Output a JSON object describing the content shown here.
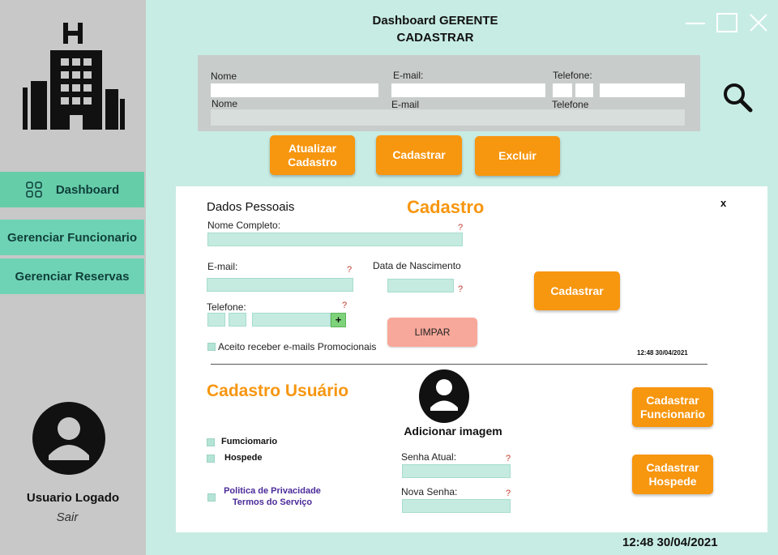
{
  "header": {
    "title_line1": "Dashboard GERENTE",
    "title_line2": "CADASTRAR"
  },
  "window_controls": [
    "minimize-icon",
    "maximize-icon",
    "close-icon"
  ],
  "sidebar": {
    "items": [
      {
        "label": "Dashboard",
        "icon": "dashboard-icon"
      },
      {
        "label": "Gerenciar Funcionario"
      },
      {
        "label": "Gerenciar Reservas"
      }
    ],
    "user_name": "Usuario Logado",
    "logout": "Sair"
  },
  "search": {
    "nome_label": "Nome",
    "email_label": "E-mail:",
    "telefone_label": "Telefone:",
    "col_nome": "Nome",
    "col_email": "E-mail",
    "col_telefone": "Telefone"
  },
  "actions": {
    "atualizar": "Atualizar Cadastro",
    "cadastrar": "Cadastrar",
    "excluir": "Excluir"
  },
  "cadastro": {
    "section_label": "Dados  Pessoais",
    "title": "Cadastro",
    "close": "x",
    "nome_completo_label": "Nome Completo:",
    "email_label": "E-mail:",
    "nascimento_label": "Data de Nascimento",
    "telefone_label": "Telefone:",
    "phone_add": "+",
    "limpar": "LIMPAR",
    "promo_label": "Aceito receber e-mails Promocionais",
    "cadastrar": "Cadastrar",
    "timestamp": "12:48  30/04/2021",
    "required_mark": "?"
  },
  "usuario": {
    "title": "Cadastro Usuário",
    "add_image": "Adicionar imagem",
    "funcionario_label": "Fumciomario",
    "hospede_label": "Hospede",
    "privacy_line1": "Politica de Privacidade",
    "privacy_line2": "Termos do Serviço",
    "senha_atual_label": "Senha Atual:",
    "nova_senha_label": "Nova Senha:",
    "cad_funcionario": "Cadastrar Funcionario",
    "cad_hospede": "Cadastrar Hospede"
  },
  "footer": {
    "timestamp": "12:48  30/04/2021"
  },
  "colors": {
    "accent_orange": "#f7960f",
    "teal_nav": "#6ed3b4",
    "background": "#c7ece4",
    "limpar": "#f8a89a",
    "privacy_text": "#4b2a99"
  }
}
